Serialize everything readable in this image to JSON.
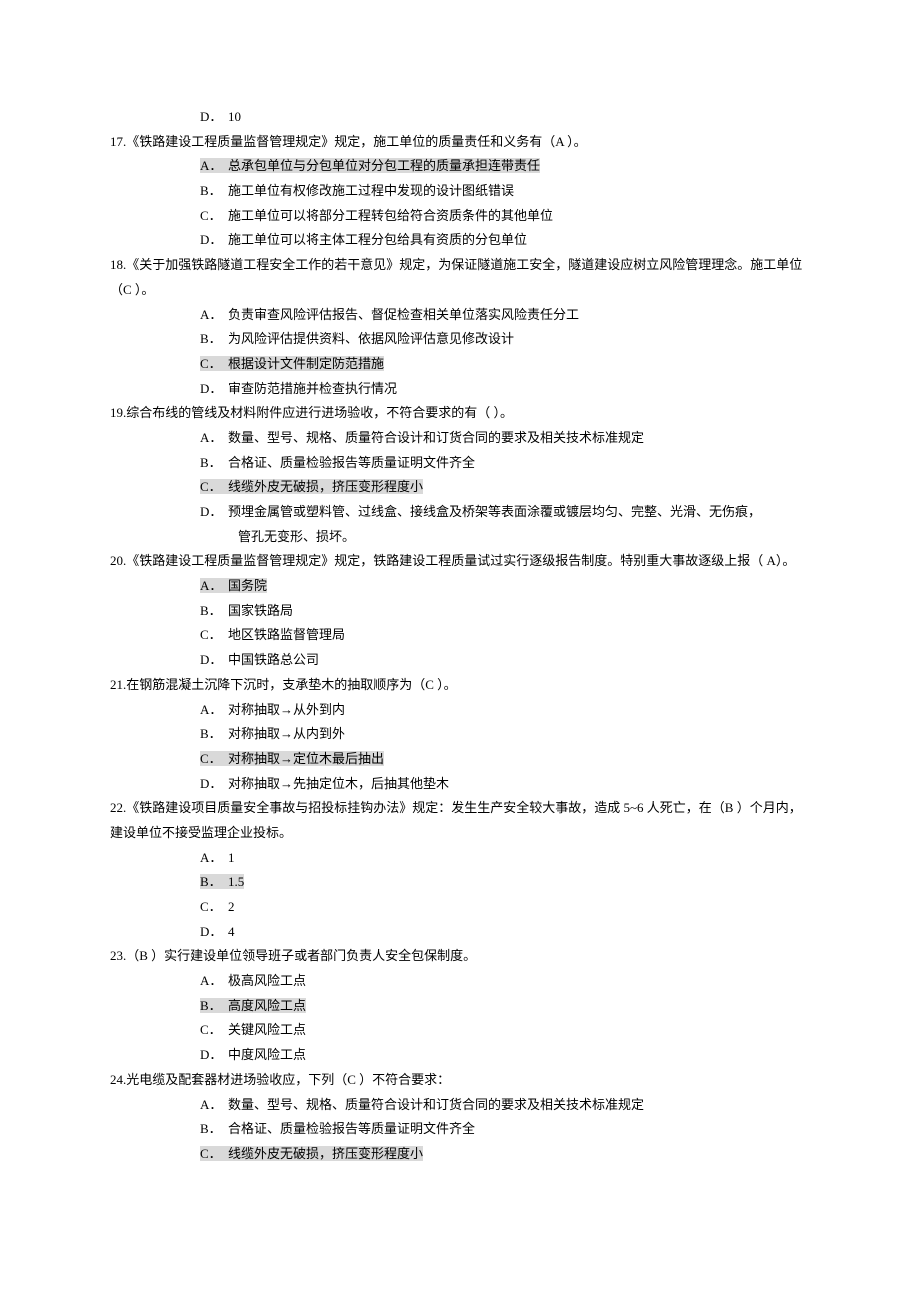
{
  "q16_d": {
    "label": "D．",
    "text": "10"
  },
  "q17": {
    "stem": "17.《铁路建设工程质量监督管理规定》规定，施工单位的质量责任和义务有（A   ）。",
    "opts": [
      {
        "label": "A．",
        "text": "总承包单位与分包单位对分包工程的质量承担连带责任",
        "hl": true
      },
      {
        "label": "B．",
        "text": "施工单位有权修改施工过程中发现的设计图纸错误"
      },
      {
        "label": "C．",
        "text": "施工单位可以将部分工程转包给符合资质条件的其他单位"
      },
      {
        "label": "D．",
        "text": "施工单位可以将主体工程分包给具有资质的分包单位"
      }
    ]
  },
  "q18": {
    "stem": "18.《关于加强铁路隧道工程安全工作的若干意见》规定，为保证隧道施工安全，隧道建设应树立风险管理理念。施工单位（C   ）。",
    "opts": [
      {
        "label": "A．",
        "text": "负责审查风险评估报告、督促检查相关单位落实风险责任分工"
      },
      {
        "label": "B．",
        "text": "为风险评估提供资料、依据风险评估意见修改设计"
      },
      {
        "label": "C．",
        "text": "根据设计文件制定防范措施",
        "hl": true
      },
      {
        "label": "D．",
        "text": "审查防范措施并检查执行情况"
      }
    ]
  },
  "q19": {
    "stem": "19.综合布线的管线及材料附件应进行进场验收，不符合要求的有（  ）。",
    "opts": [
      {
        "label": "A．",
        "text": "数量、型号、规格、质量符合设计和订货合同的要求及相关技术标准规定"
      },
      {
        "label": "B．",
        "text": "合格证、质量检验报告等质量证明文件齐全"
      },
      {
        "label": "C．",
        "text": "线缆外皮无破损，挤压变形程度小",
        "hl": true
      },
      {
        "label": "D．",
        "text": "预埋金属管或塑料管、过线盒、接线盒及桥架等表面涂覆或镀层均匀、完整、光滑、无伤痕，",
        "cont": "管孔无变形、损坏。"
      }
    ]
  },
  "q20": {
    "stem": "20.《铁路建设工程质量监督管理规定》规定，铁路建设工程质量试过实行逐级报告制度。特别重大事故逐级上报（  A）。",
    "opts": [
      {
        "label": "A．",
        "text": "国务院",
        "hl": true
      },
      {
        "label": "B．",
        "text": "国家铁路局"
      },
      {
        "label": "C．",
        "text": "地区铁路监督管理局"
      },
      {
        "label": "D．",
        "text": "中国铁路总公司"
      }
    ]
  },
  "q21": {
    "stem": "21.在钢筋混凝土沉降下沉时，支承垫木的抽取顺序为（C   ）。",
    "opts": [
      {
        "label": "A．",
        "text": "对称抽取→从外到内"
      },
      {
        "label": "B．",
        "text": "对称抽取→从内到外"
      },
      {
        "label": "C．",
        "text": "对称抽取→定位木最后抽出",
        "hl": true
      },
      {
        "label": "D．",
        "text": "对称抽取→先抽定位木，后抽其他垫木"
      }
    ]
  },
  "q22": {
    "stem": "22.《铁路建设项目质量安全事故与招投标挂钩办法》规定：发生生产安全较大事故，造成 5~6 人死亡，在（B   ）个月内，建设单位不接受监理企业投标。",
    "opts": [
      {
        "label": "A．",
        "text": "1"
      },
      {
        "label": "B．",
        "text": "1.5",
        "hl": true
      },
      {
        "label": "C．",
        "text": "2"
      },
      {
        "label": "D．",
        "text": "4"
      }
    ]
  },
  "q23": {
    "stem": "23.（B   ）实行建设单位领导班子或者部门负责人安全包保制度。",
    "opts": [
      {
        "label": "A．",
        "text": "极高风险工点"
      },
      {
        "label": "B．",
        "text": "高度风险工点",
        "hl": true
      },
      {
        "label": "C．",
        "text": "关键风险工点"
      },
      {
        "label": "D．",
        "text": "中度风险工点"
      }
    ]
  },
  "q24": {
    "stem": "24.光电缆及配套器材进场验收应，下列（C   ）不符合要求：",
    "opts": [
      {
        "label": "A．",
        "text": "数量、型号、规格、质量符合设计和订货合同的要求及相关技术标准规定"
      },
      {
        "label": "B．",
        "text": "合格证、质量检验报告等质量证明文件齐全"
      },
      {
        "label": "C．",
        "text": "线缆外皮无破损，挤压变形程度小",
        "hl": true
      }
    ]
  }
}
